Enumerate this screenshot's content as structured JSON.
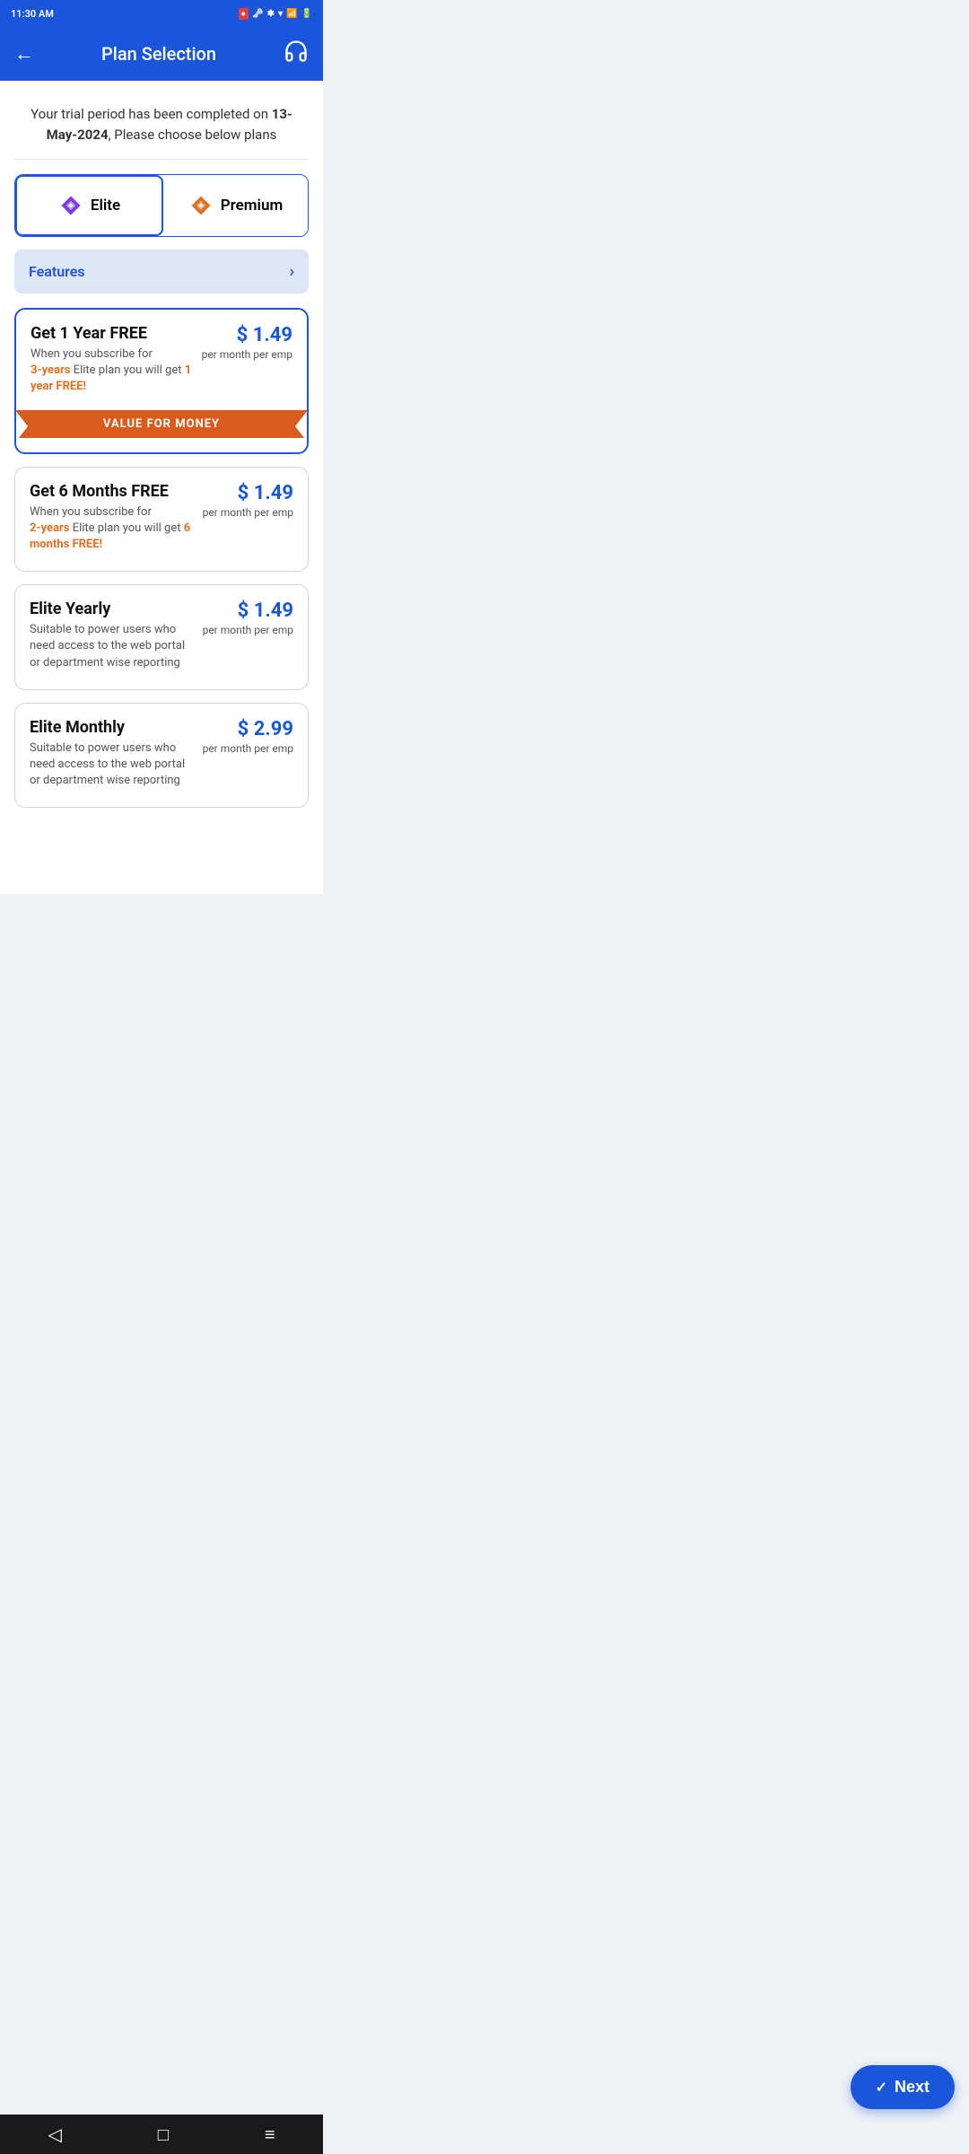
{
  "statusBar": {
    "time": "11:30 AM",
    "icons": [
      "screen-record",
      "cast",
      "vpn",
      "google"
    ]
  },
  "header": {
    "title": "Plan Selection",
    "backLabel": "←",
    "supportIconLabel": "headset"
  },
  "trialMessage": {
    "prefix": "Your trial period has been completed on ",
    "date": "13-May-2024",
    "suffix": ", Please choose below plans"
  },
  "planTabs": [
    {
      "id": "elite",
      "label": "Elite",
      "active": true
    },
    {
      "id": "premium",
      "label": "Premium",
      "active": false
    }
  ],
  "featuresRow": {
    "label": "Features",
    "chevron": "›"
  },
  "planCards": [
    {
      "id": "year-free",
      "title": "Get 1 Year FREE",
      "subLine1": "When you subscribe for",
      "highlight1": "3-years",
      "subLine2": " Elite plan you will get ",
      "highlight2": "1 year FREE!",
      "price": "$ 1.49",
      "period": "per month per emp",
      "badge": "VALUE FOR MONEY",
      "selected": true
    },
    {
      "id": "6months-free",
      "title": "Get 6 Months FREE",
      "subLine1": "When you subscribe for",
      "highlight1": "2-years",
      "subLine2": " Elite plan you will get ",
      "highlight2": "6 months FREE!",
      "price": "$ 1.49",
      "period": "per month per emp",
      "badge": null,
      "selected": false
    },
    {
      "id": "elite-yearly",
      "title": "Elite Yearly",
      "subLine1": "Suitable to power users who need access to the web portal or department wise reporting",
      "highlight1": null,
      "subLine2": null,
      "highlight2": null,
      "price": "$ 1.49",
      "period": "per month per emp",
      "badge": null,
      "selected": false
    },
    {
      "id": "elite-monthly",
      "title": "Elite Monthly",
      "subLine1": "Suitable to power users who need access to the web portal or department wise reporting",
      "highlight1": null,
      "subLine2": null,
      "highlight2": null,
      "price": "$ 2.99",
      "period": "per month per emp",
      "badge": null,
      "selected": false
    }
  ],
  "nextButton": {
    "label": "Next",
    "checkmark": "✓"
  },
  "bottomNav": {
    "back": "◁",
    "home": "□",
    "menu": "≡"
  }
}
